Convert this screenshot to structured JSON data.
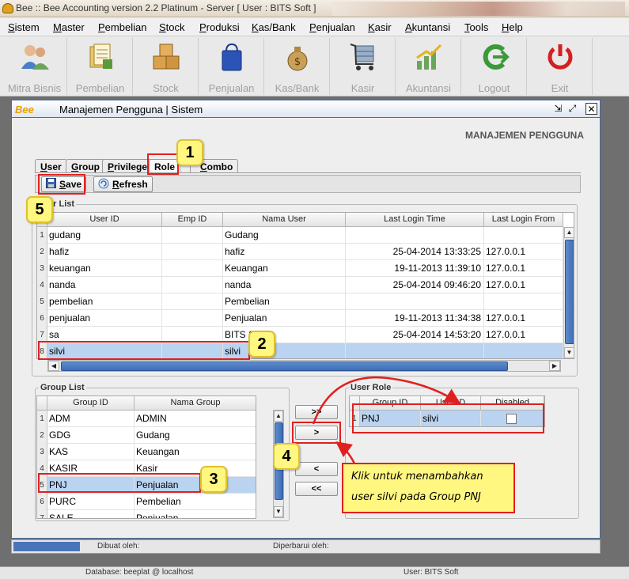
{
  "window": {
    "title": "Bee :: Bee Accounting version 2.2 Platinum - Server  [ User : BITS Soft ]"
  },
  "menu": [
    "Sistem",
    "Master",
    "Pembelian",
    "Stock",
    "Produksi",
    "Kas/Bank",
    "Penjualan",
    "Kasir",
    "Akuntansi",
    "Tools",
    "Help"
  ],
  "toolbar": [
    {
      "label": "Mitra Bisnis",
      "icon": "people-icon"
    },
    {
      "label": "Pembelian",
      "icon": "documents-icon"
    },
    {
      "label": "Stock",
      "icon": "boxes-icon"
    },
    {
      "label": "Penjualan",
      "icon": "shopping-bag-icon"
    },
    {
      "label": "Kas/Bank",
      "icon": "money-bag-icon"
    },
    {
      "label": "Kasir",
      "icon": "cart-icon"
    },
    {
      "label": "Akuntansi",
      "icon": "chart-up-icon"
    },
    {
      "label": "Logout",
      "icon": "logout-icon"
    },
    {
      "label": "Exit",
      "icon": "power-icon"
    }
  ],
  "inner_window": {
    "logo": "Bee",
    "title": "Manajemen Pengguna | Sistem",
    "heading": "MANAJEMEN PENGGUNA"
  },
  "tabs": [
    "User",
    "Group",
    "Privilege",
    "Role",
    "Combo"
  ],
  "actions": {
    "save": "Save",
    "refresh": "Refresh"
  },
  "user_list": {
    "title": "User List",
    "columns": [
      "User ID",
      "Emp ID",
      "Nama User",
      "Last Login Time",
      "Last Login From"
    ],
    "rows": [
      {
        "n": "1",
        "user_id": "gudang",
        "emp_id": "",
        "nama": "Gudang",
        "time": "",
        "from": ""
      },
      {
        "n": "2",
        "user_id": "hafiz",
        "emp_id": "",
        "nama": "hafiz",
        "time": "25-04-2014 13:33:25",
        "from": "127.0.0.1"
      },
      {
        "n": "3",
        "user_id": "keuangan",
        "emp_id": "",
        "nama": "Keuangan",
        "time": "19-11-2013 11:39:10",
        "from": "127.0.0.1"
      },
      {
        "n": "4",
        "user_id": "nanda",
        "emp_id": "",
        "nama": "nanda",
        "time": "25-04-2014 09:46:20",
        "from": "127.0.0.1"
      },
      {
        "n": "5",
        "user_id": "pembelian",
        "emp_id": "",
        "nama": "Pembelian",
        "time": "",
        "from": ""
      },
      {
        "n": "6",
        "user_id": "penjualan",
        "emp_id": "",
        "nama": "Penjualan",
        "time": "19-11-2013 11:34:38",
        "from": "127.0.0.1"
      },
      {
        "n": "7",
        "user_id": "sa",
        "emp_id": "",
        "nama": "BITS Soft",
        "time": "25-04-2014 14:53:20",
        "from": "127.0.0.1"
      },
      {
        "n": "8",
        "user_id": "silvi",
        "emp_id": "",
        "nama": "silvi",
        "time": "",
        "from": ""
      }
    ]
  },
  "group_list": {
    "title": "Group List",
    "columns": [
      "Group ID",
      "Nama Group"
    ],
    "rows": [
      {
        "n": "1",
        "id": "ADM",
        "nama": "ADMIN"
      },
      {
        "n": "2",
        "id": "GDG",
        "nama": "Gudang"
      },
      {
        "n": "3",
        "id": "KAS",
        "nama": "Keuangan"
      },
      {
        "n": "4",
        "id": "KASIR",
        "nama": "Kasir"
      },
      {
        "n": "5",
        "id": "PNJ",
        "nama": "Penjualan"
      },
      {
        "n": "6",
        "id": "PURC",
        "nama": "Pembelian"
      },
      {
        "n": "7",
        "id": "SALE",
        "nama": "Penjualan"
      }
    ]
  },
  "move_buttons": [
    ">>",
    ">",
    "<",
    "<<"
  ],
  "user_role": {
    "title": "User Role",
    "columns": [
      "Group ID",
      "User ID",
      "Disabled"
    ],
    "rows": [
      {
        "n": "1",
        "group": "PNJ",
        "user": "silvi",
        "disabled": false
      }
    ]
  },
  "annotations": {
    "badges": [
      "1",
      "2",
      "3",
      "4",
      "5"
    ],
    "callout": [
      "Klik untuk menambahkan",
      "user silvi pada Group PNJ"
    ]
  },
  "status": {
    "dibuat": "Dibuat oleh:",
    "diperbarui": "Diperbarui oleh:",
    "database": "Database: beeplat @ localhost",
    "user": "User: BITS Soft"
  }
}
